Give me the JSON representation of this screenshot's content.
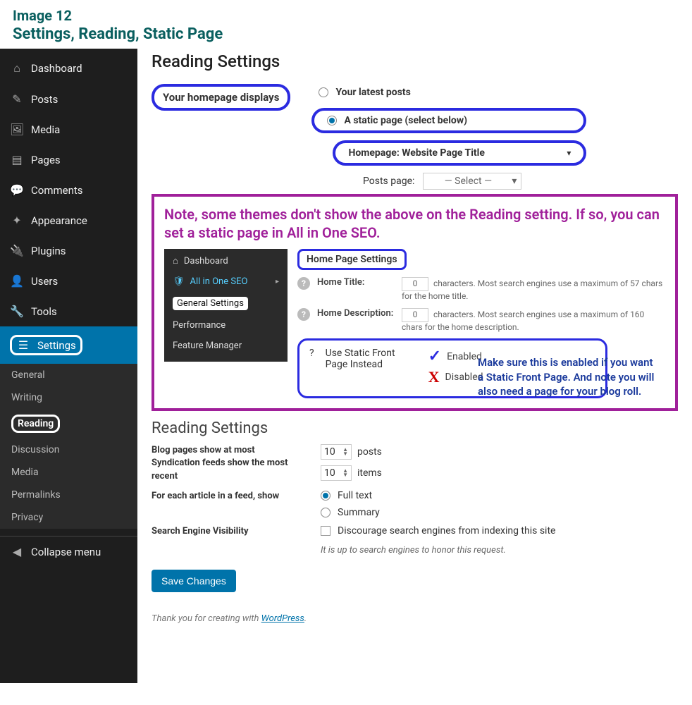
{
  "doc": {
    "title": "Image 12",
    "subtitle": "Settings, Reading, Static Page"
  },
  "sidebar": {
    "items": [
      {
        "label": "Dashboard",
        "icon": "⌂"
      },
      {
        "label": "Posts",
        "icon": "✎"
      },
      {
        "label": "Media",
        "icon": "🖼"
      },
      {
        "label": "Pages",
        "icon": "▤"
      },
      {
        "label": "Comments",
        "icon": "💬"
      },
      {
        "label": "Appearance",
        "icon": "✦"
      },
      {
        "label": "Plugins",
        "icon": "🔌"
      },
      {
        "label": "Users",
        "icon": "👤"
      },
      {
        "label": "Tools",
        "icon": "🔧"
      },
      {
        "label": "Settings",
        "icon": "☰"
      }
    ],
    "subs": [
      {
        "label": "General"
      },
      {
        "label": "Writing"
      },
      {
        "label": "Reading",
        "active": true
      },
      {
        "label": "Discussion"
      },
      {
        "label": "Media"
      },
      {
        "label": "Permalinks"
      },
      {
        "label": "Privacy"
      }
    ],
    "collapse": "Collapse menu",
    "collapse_icon": "◀"
  },
  "reading": {
    "heading": "Reading Settings",
    "homepage_label": "Your homepage displays",
    "opt_latest": "Your latest posts",
    "opt_static": "A static page (select below)",
    "homepage_select": "Homepage: Website Page Title",
    "posts_page_label": "Posts page:",
    "posts_page_select": "— Select —"
  },
  "note": {
    "text": "Note, some themes don't show the above on the Reading setting. If so, you can set a static page in All in One SEO.",
    "mini_sidebar": {
      "dashboard": "Dashboard",
      "aioseo": "All in One SEO",
      "general": "General Settings",
      "performance": "Performance",
      "feature": "Feature Manager"
    },
    "hs": {
      "title": "Home Page Settings",
      "home_title_label": "Home Title:",
      "home_title_count": "0",
      "home_title_desc": "characters. Most search engines use a maximum of 57 chars for the home title.",
      "home_desc_label": "Home Description:",
      "home_desc_count": "0",
      "home_desc_desc": "characters. Most search engines use a maximum of 160 chars for the home description.",
      "static_label": "Use Static Front Page Instead",
      "opt_enabled": "Enabled",
      "opt_disabled": "Disabled"
    },
    "blue_note": "Make sure this is enabled if you want a Static Front Page. And note you will also need a page for your blog roll."
  },
  "lower": {
    "heading": "Reading Settings",
    "blog_label": "Blog pages show at most",
    "blog_val": "10",
    "blog_unit": "posts",
    "synd_label": "Syndication feeds show the most recent",
    "synd_val": "10",
    "synd_unit": "items",
    "feed_label": "For each article in a feed, show",
    "feed_full": "Full text",
    "feed_summary": "Summary",
    "sev_label": "Search Engine Visibility",
    "sev_checkbox": "Discourage search engines from indexing this site",
    "sev_hint": "It is up to search engines to honor this request.",
    "save": "Save Changes"
  },
  "footer": {
    "text": "Thank you for creating with ",
    "link": "WordPress",
    "suffix": "."
  }
}
